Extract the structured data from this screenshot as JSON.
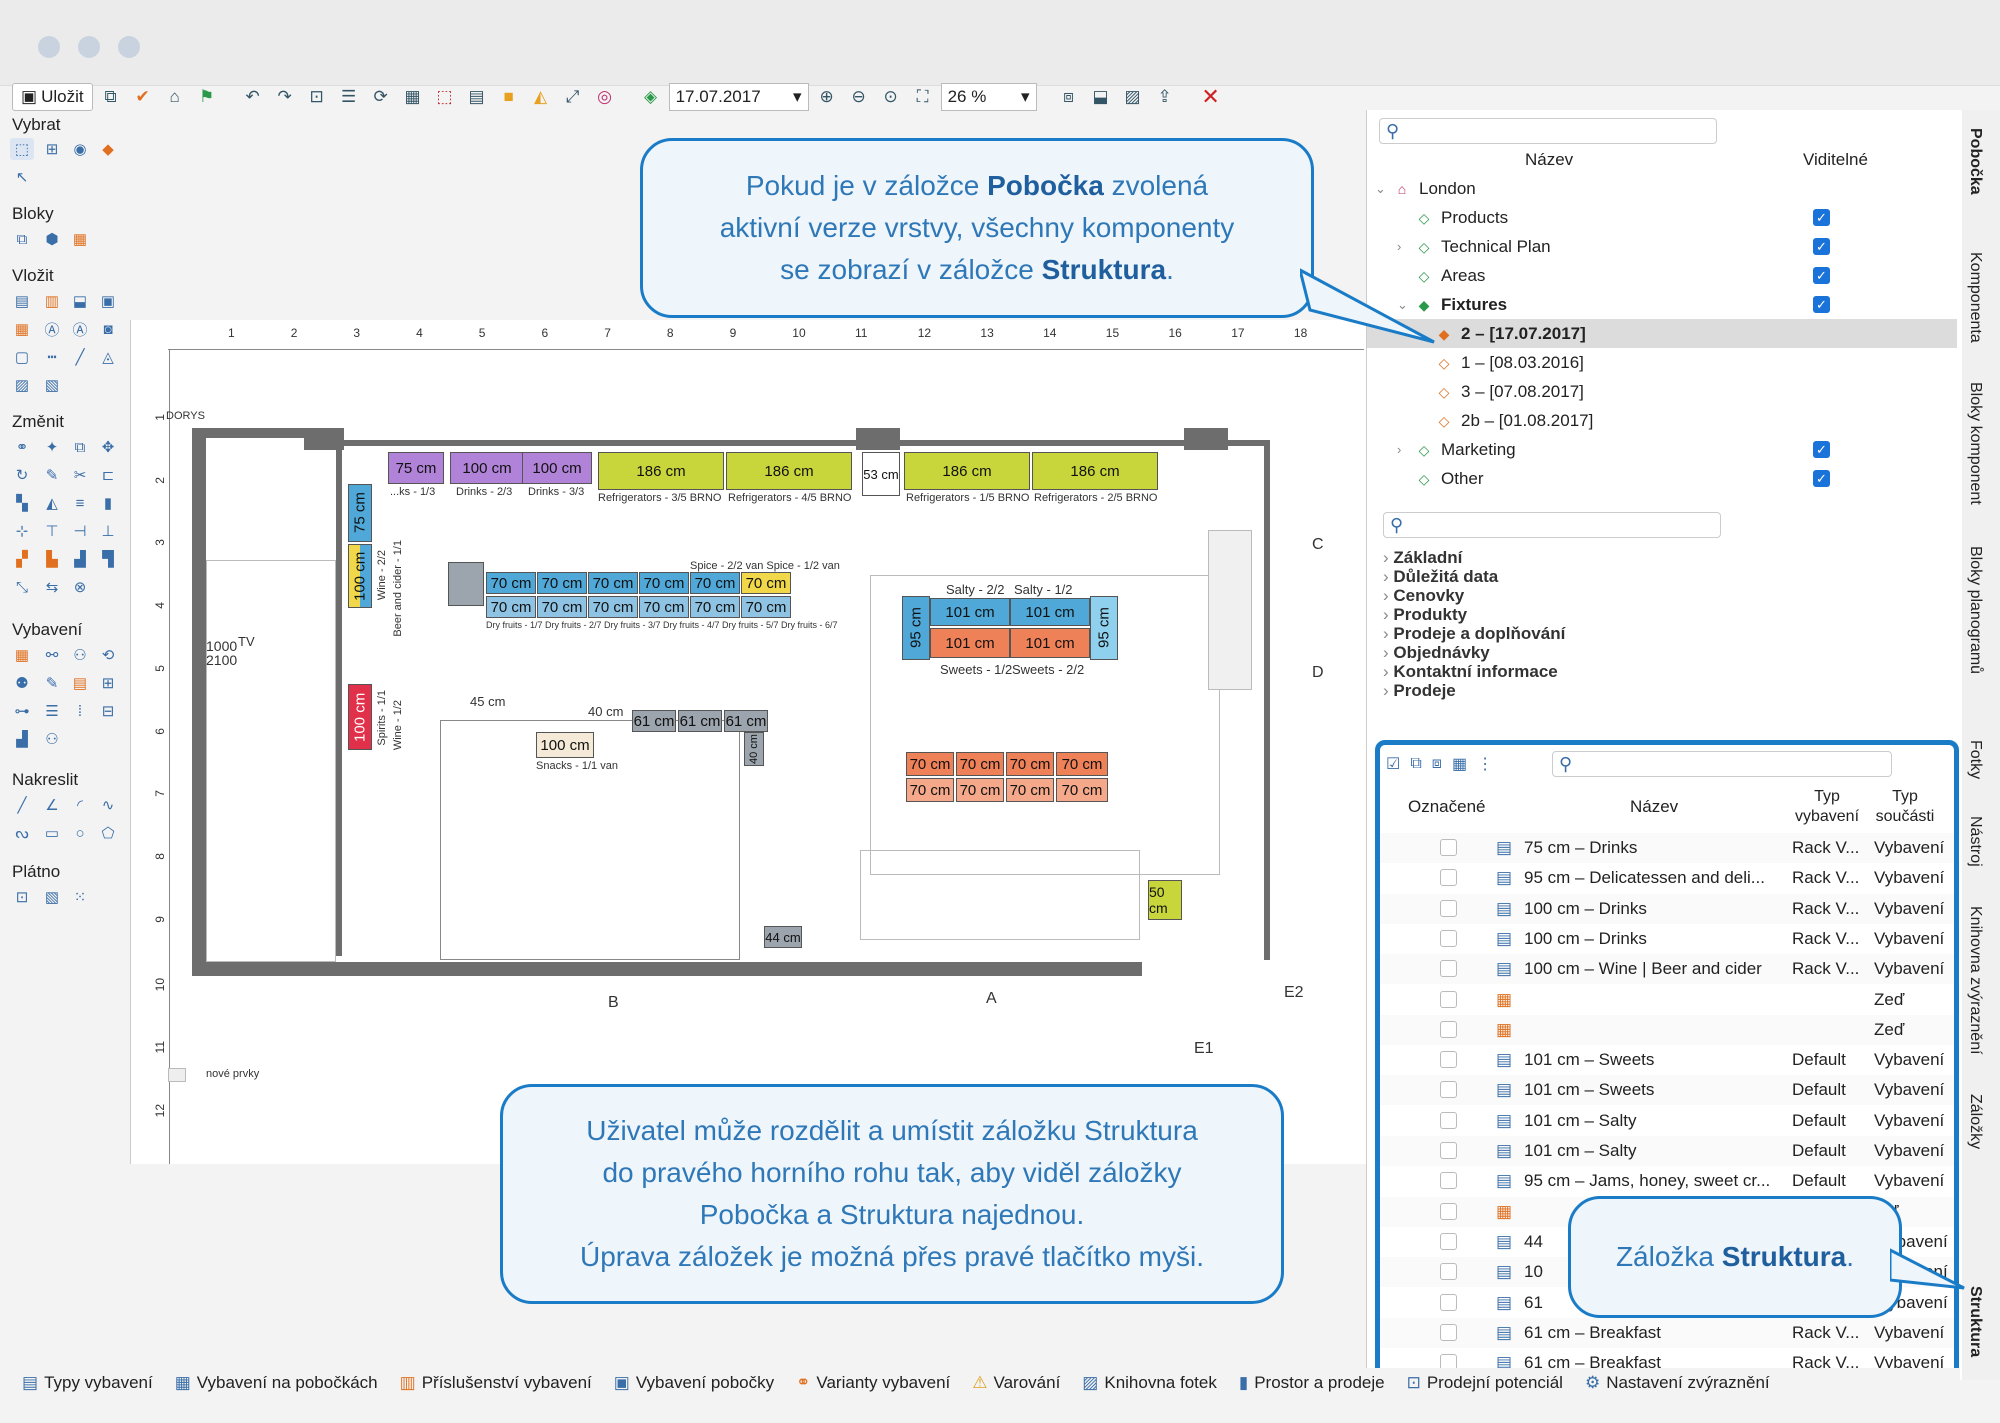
{
  "toolbar": {
    "save_label": "Uložit",
    "date_value": "17.07.2017",
    "zoom_value": "26 %"
  },
  "left_panel": {
    "sections": [
      "Vybrat",
      "Bloky",
      "Vložit",
      "Změnit",
      "Vybavení",
      "Nakreslit",
      "Plátno"
    ]
  },
  "plan": {
    "ruler_h": [
      "1",
      "2",
      "3",
      "4",
      "5",
      "6",
      "7",
      "8",
      "9",
      "10",
      "11",
      "12",
      "13",
      "14",
      "15",
      "16",
      "17",
      "18"
    ],
    "ruler_v": [
      "1",
      "2",
      "3",
      "4",
      "5",
      "6",
      "7",
      "8",
      "9",
      "10",
      "11",
      "12"
    ],
    "fixtures": {
      "purple": [
        "75 cm",
        "100 cm",
        "100 cm"
      ],
      "lime": [
        "186 cm",
        "186 cm",
        "186 cm",
        "186 cm"
      ],
      "small": "53 cm",
      "left_vertical": [
        "75 cm",
        "100 cm",
        "100 cm"
      ],
      "blue_row1": [
        "70 cm",
        "70 cm",
        "70 cm",
        "70 cm",
        "70 cm",
        "70 cm"
      ],
      "blue_row2": [
        "70 cm",
        "70 cm",
        "70 cm",
        "70 cm",
        "70 cm",
        "70 cm"
      ],
      "island": [
        "101 cm",
        "101 cm",
        "101 cm",
        "101 cm",
        "95 cm",
        "95 cm"
      ],
      "orange_row1": [
        "70 cm",
        "70 cm",
        "70 cm",
        "70 cm"
      ],
      "orange_row2": [
        "70 cm",
        "70 cm",
        "70 cm",
        "70 cm"
      ],
      "gray_row": [
        "61 cm",
        "61 cm",
        "61 cm",
        "40 cm"
      ],
      "snacks": "100 cm",
      "wide_45": "45 cm",
      "wide_40": "40 cm",
      "lime_small": "50 cm",
      "bottom_gray": "44 cm"
    },
    "captions": {
      "c_purple": [
        "...ks - 1/3",
        "Drinks - 2/3",
        "Drinks - 3/3"
      ],
      "c_lime": [
        "Refrigerators - 3/5 BRNO",
        "Refrigerators - 4/5 BRNO",
        "Refrigerators - 1/5 BRNO",
        "Refrigerators - 2/5 BRNO"
      ],
      "c_vertical": [
        "Wine - 2/2",
        "Beer and cider - 1/1",
        "Spirits - 1/1",
        "Wine - 1/2"
      ],
      "c_island": [
        "Salty - 2/2",
        "Salty - 1/2",
        "Sweets - 1/2",
        "Sweets - 2/2"
      ],
      "c_snacks": "Snacks - 1/1 van",
      "c_dry": "Dry fruits - 1/7 Dry fruits - 2/7 Dry fruits - 3/7 Dry fruits - 4/7 Dry fruits - 5/7 Dry fruits - 6/7",
      "c_spice": "Spice - 2/2 van Spice - 1/2 van",
      "legend": "nové prvky",
      "doors": "DORYS",
      "sections": [
        "A",
        "B",
        "C",
        "D",
        "E1",
        "E2"
      ],
      "misc_numbers": [
        "1000",
        "2100",
        "TV"
      ]
    }
  },
  "callouts": {
    "top_line1_a": "Pokud je v záložce ",
    "top_line1_b": "Pobočka",
    "top_line1_c": " zvolená",
    "top_line2": "aktivní verze vrstvy, všechny komponenty",
    "top_line3_a": "se zobrazí v záložce ",
    "top_line3_b": "Struktura",
    "top_line3_c": ".",
    "bottom_line1": "Uživatel může rozdělit a umístit záložku Struktura",
    "bottom_line2": "do pravého horního rohu tak, aby viděl záložky",
    "bottom_line3": "Pobočka a Struktura najednou.",
    "bottom_line4": "Úprava záložek je možná přes pravé tlačítko myši.",
    "struct_a": "Záložka ",
    "struct_b": "Struktura",
    "struct_c": "."
  },
  "branch_panel": {
    "col_name": "Název",
    "col_visible": "Viditelné",
    "rows": [
      {
        "label": "London",
        "visible": null
      },
      {
        "label": "Products",
        "visible": true
      },
      {
        "label": "Technical Plan",
        "visible": true
      },
      {
        "label": "Areas",
        "visible": true
      },
      {
        "label": "Fixtures",
        "visible": true
      },
      {
        "label": "2 – [17.07.2017]",
        "visible": null
      },
      {
        "label": "1 – [08.03.2016]",
        "visible": null
      },
      {
        "label": "3 – [07.08.2017]",
        "visible": null
      },
      {
        "label": "2b – [01.08.2017]",
        "visible": null
      },
      {
        "label": "Marketing",
        "visible": true
      },
      {
        "label": "Other",
        "visible": true
      }
    ]
  },
  "properties": {
    "groups": [
      "Základní",
      "Důležitá data",
      "Cenovky",
      "Produkty",
      "Prodeje a doplňování",
      "Objednávky",
      "Kontaktní informace",
      "Prodeje"
    ]
  },
  "structure": {
    "col_marked": "Označené",
    "col_name": "Název",
    "col_type1": "Typ vybavení",
    "col_type2": "Typ součásti",
    "rows": [
      {
        "name": "75 cm – Drinks",
        "type": "Rack V...",
        "part": "Vybavení"
      },
      {
        "name": "95 cm – Delicatessen and deli...",
        "type": "Rack V...",
        "part": "Vybavení"
      },
      {
        "name": "100 cm – Drinks",
        "type": "Rack V...",
        "part": "Vybavení"
      },
      {
        "name": "100 cm – Drinks",
        "type": "Rack V...",
        "part": "Vybavení"
      },
      {
        "name": "100 cm – Wine | Beer and cider",
        "type": "Rack V...",
        "part": "Vybavení"
      },
      {
        "name": "",
        "type": "",
        "part": "Zeď"
      },
      {
        "name": "",
        "type": "",
        "part": "Zeď"
      },
      {
        "name": "101 cm – Sweets",
        "type": "Default",
        "part": "Vybavení"
      },
      {
        "name": "101 cm – Sweets",
        "type": "Default",
        "part": "Vybavení"
      },
      {
        "name": "101 cm – Salty",
        "type": "Default",
        "part": "Vybavení"
      },
      {
        "name": "101 cm – Salty",
        "type": "Default",
        "part": "Vybavení"
      },
      {
        "name": "95 cm – Jams, honey, sweet cr...",
        "type": "Default",
        "part": "Vybavení"
      },
      {
        "name": "",
        "type": "",
        "part": "...ď"
      },
      {
        "name": "44",
        "type": "",
        "part": "...ybavení"
      },
      {
        "name": "10",
        "type": "",
        "part": "...ybavení"
      },
      {
        "name": "61",
        "type": "",
        "part": "...ybavení"
      },
      {
        "name": "61 cm – Breakfast",
        "type": "Rack V...",
        "part": "Vybavení"
      },
      {
        "name": "61 cm – Breakfast",
        "type": "Rack V...",
        "part": "Vybavení"
      }
    ]
  },
  "vertical_tabs": [
    "Pobočka",
    "Komponenta",
    "Bloky komponent",
    "Bloky planogramů",
    "Fotky",
    "Nástroj",
    "Knihovna zvýraznění",
    "Záložky",
    "Struktura"
  ],
  "bottom_bar": [
    "Typy vybavení",
    "Vybavení na pobočkách",
    "Příslušenství vybavení",
    "Vybavení pobočky",
    "Varianty vybavení",
    "Varování",
    "Knihovna fotek",
    "Prostor a prodeje",
    "Prodejní potenciál",
    "Nastavení zvýraznění"
  ],
  "colors": {
    "accent": "#1a7cc7",
    "checkbox": "#1a73d9",
    "purple": "#b183d8",
    "lime": "#c8d63b",
    "blue": "#4fa8d8",
    "orange": "#ef8159",
    "red": "#e0304a"
  }
}
